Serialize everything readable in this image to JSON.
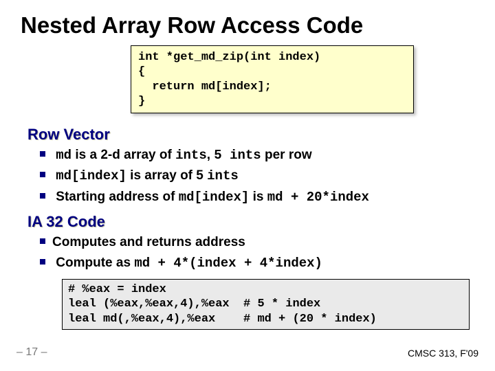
{
  "title": "Nested Array Row Access Code",
  "code1": "int *get_md_zip(int index)\n{\n  return md[index];\n}",
  "section1": {
    "heading": "Row Vector",
    "items": [
      {
        "pre": "md",
        "mid": " is a 2-d array of ",
        "mono2": "ints",
        "sep": ", ",
        "mono3": "5 ints",
        "tail": " per row"
      },
      {
        "mono1": "md[index]",
        "mid": " is array of 5 ",
        "mono2": "ints"
      },
      {
        "pre": "Starting address of ",
        "mono1": "md[index]",
        "mid": " is ",
        "mono2": "md + 20*index"
      }
    ]
  },
  "section2": {
    "heading": "IA 32 Code",
    "items": [
      "Computes and returns address",
      {
        "pre": "Compute as    ",
        "mono": "md + 4*(index + 4*index)"
      }
    ]
  },
  "code2": "# %eax = index\nleal (%eax,%eax,4),%eax  # 5 * index\nleal md(,%eax,4),%eax    # md + (20 * index)",
  "footer": {
    "left": "– 17 –",
    "right": "CMSC 313, F'09"
  }
}
